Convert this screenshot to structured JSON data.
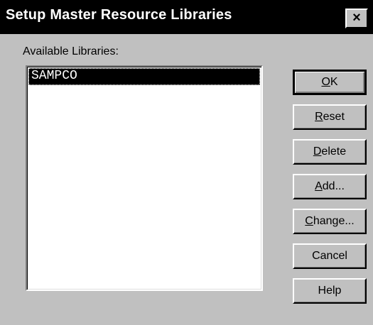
{
  "window": {
    "title": "Setup Master Resource Libraries",
    "close_label": "×"
  },
  "libraries": {
    "label": "Available Libraries:",
    "items": [
      {
        "name": "SAMPCO",
        "selected": true
      }
    ]
  },
  "buttons": {
    "ok": {
      "mnemonic": "O",
      "rest": "K"
    },
    "reset": {
      "mnemonic": "R",
      "rest": "eset"
    },
    "delete": {
      "mnemonic": "D",
      "rest": "elete"
    },
    "add": {
      "mnemonic": "A",
      "rest": "dd..."
    },
    "change": {
      "mnemonic": "C",
      "rest": "hange..."
    },
    "cancel": {
      "label": "Cancel"
    },
    "help": {
      "label": "Help"
    }
  },
  "colors": {
    "dialog_background": "#c0c0c0",
    "titlebar_background": "#000000",
    "titlebar_text": "#ffffff",
    "selection_background": "#000000",
    "selection_text": "#ffffff"
  }
}
